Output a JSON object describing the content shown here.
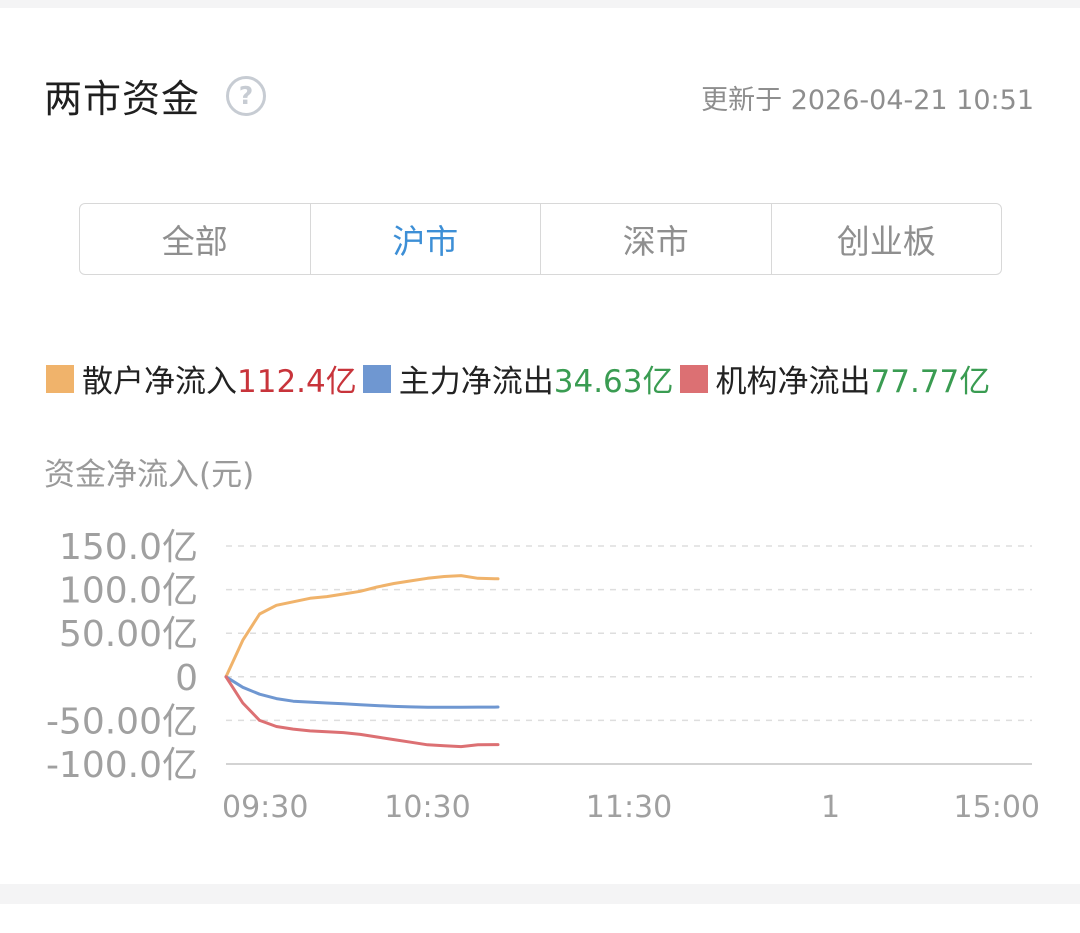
{
  "header": {
    "title": "两市资金",
    "help_icon": "question-circle-icon",
    "updated": "更新于 2026-04-21 10:51"
  },
  "tabs": [
    {
      "label": "全部",
      "active": false
    },
    {
      "label": "沪市",
      "active": true
    },
    {
      "label": "深市",
      "active": false
    },
    {
      "label": "创业板",
      "active": false
    }
  ],
  "legend": [
    {
      "label": "散户净流入",
      "value": "112.4亿",
      "swatch": "#f0b36b",
      "value_color": "#c8343b"
    },
    {
      "label": "主力净流出",
      "value": "34.63亿",
      "swatch": "#6f97d1",
      "value_color": "#3a9c52"
    },
    {
      "label": "机构净流出",
      "value": "77.77亿",
      "swatch": "#dc7073",
      "value_color": "#3a9c52"
    }
  ],
  "axis_title": "资金净流入(元)",
  "chart_data": {
    "type": "line",
    "ylabel": "资金净流入(元)",
    "y_unit": "亿",
    "ylim": [
      -100,
      150
    ],
    "yticks": [
      150,
      100,
      50,
      0,
      -50,
      -100
    ],
    "ytick_labels": [
      "150.0亿",
      "100.0亿",
      "50.00亿",
      "0",
      "-50.00亿",
      "-100.0亿"
    ],
    "x_domain": [
      "09:30",
      "15:00"
    ],
    "xticks": [
      "09:30",
      "10:30",
      "11:30",
      "14:00",
      "15:00"
    ],
    "xtick_labels": [
      "09:30",
      "10:30",
      "11:30",
      "1",
      "15:00"
    ],
    "grid": true,
    "x": [
      "09:30",
      "09:35",
      "09:40",
      "09:45",
      "09:50",
      "09:55",
      "10:00",
      "10:05",
      "10:10",
      "10:15",
      "10:20",
      "10:25",
      "10:30",
      "10:35",
      "10:40",
      "10:45",
      "10:50",
      "10:51"
    ],
    "series": [
      {
        "name": "散户净流入",
        "color": "#f0b36b",
        "values": [
          0,
          42,
          72,
          82,
          86,
          90,
          92,
          95,
          98,
          103,
          107,
          110,
          113,
          115,
          116,
          113,
          112.5,
          112.4
        ]
      },
      {
        "name": "主力净流出",
        "color": "#6f97d1",
        "values": [
          0,
          -12,
          -20,
          -25,
          -28,
          -29,
          -30,
          -31,
          -32,
          -33,
          -34,
          -34.5,
          -35,
          -35,
          -35,
          -34.8,
          -34.7,
          -34.63
        ]
      },
      {
        "name": "机构净流出",
        "color": "#dc7073",
        "values": [
          0,
          -30,
          -50,
          -57,
          -60,
          -62,
          -63,
          -64,
          -66,
          -69,
          -72,
          -75,
          -78,
          -79,
          -80,
          -78,
          -77.8,
          -77.77
        ]
      }
    ]
  }
}
